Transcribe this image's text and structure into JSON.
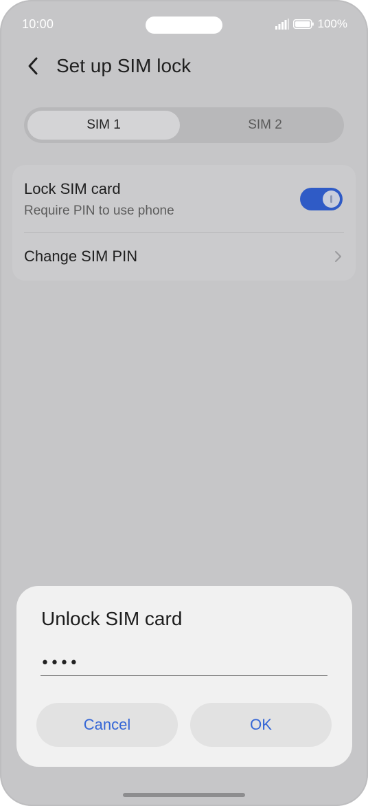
{
  "status_bar": {
    "time": "10:00",
    "battery": "100%"
  },
  "header": {
    "title": "Set up SIM lock"
  },
  "sim_tabs": [
    {
      "label": "SIM 1",
      "selected": true
    },
    {
      "label": "SIM 2",
      "selected": false
    }
  ],
  "settings": {
    "lock_sim_card": {
      "title": "Lock SIM card",
      "subtitle": "Require PIN to use phone",
      "enabled": true
    },
    "change_pin": {
      "label": "Change SIM PIN"
    }
  },
  "dialog": {
    "title": "Unlock SIM card",
    "pin_value": "••••",
    "cancel_label": "Cancel",
    "ok_label": "OK"
  },
  "colors": {
    "accent": "#2f5bc6",
    "button_text": "#3566d6",
    "overlay_background": "#c6c6c8",
    "dialog_background": "#f1f1f1"
  }
}
